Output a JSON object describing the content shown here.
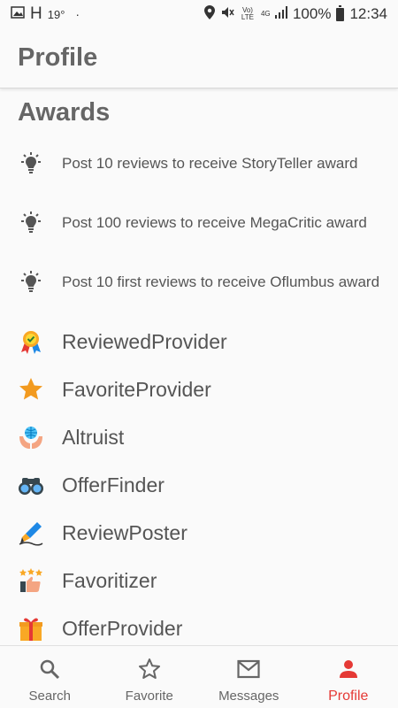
{
  "status_bar": {
    "carrier": "H",
    "temperature": "19°",
    "dot": "·",
    "network_badge_volte": "Vo) LTE",
    "network_badge_4g": "4G",
    "battery": "100%",
    "time": "12:34"
  },
  "app_bar": {
    "title": "Profile"
  },
  "awards_section": {
    "title": "Awards",
    "goals": [
      {
        "icon": "lightbulb-icon",
        "label": "Post 10 reviews to receive StoryTeller award"
      },
      {
        "icon": "lightbulb-icon",
        "label": "Post 100 reviews to receive MegaCritic award"
      },
      {
        "icon": "lightbulb-icon",
        "label": "Post 10 first reviews to receive Oflumbus award"
      }
    ],
    "awards": [
      {
        "icon": "medal-icon",
        "label": "ReviewedProvider"
      },
      {
        "icon": "star-icon",
        "label": "FavoriteProvider"
      },
      {
        "icon": "globe-hands-icon",
        "label": "Altruist"
      },
      {
        "icon": "binoculars-icon",
        "label": "OfferFinder"
      },
      {
        "icon": "pen-icon",
        "label": "ReviewPoster"
      },
      {
        "icon": "stars-thumbsup-icon",
        "label": "Favoritizer"
      },
      {
        "icon": "gift-icon",
        "label": "OfferProvider"
      }
    ]
  },
  "bottom_nav": {
    "items": [
      {
        "icon": "search-icon",
        "label": "Search"
      },
      {
        "icon": "star-outline-icon",
        "label": "Favorite"
      },
      {
        "icon": "mail-icon",
        "label": "Messages"
      },
      {
        "icon": "person-icon",
        "label": "Profile",
        "active": true
      }
    ],
    "active_color": "#e53935"
  }
}
